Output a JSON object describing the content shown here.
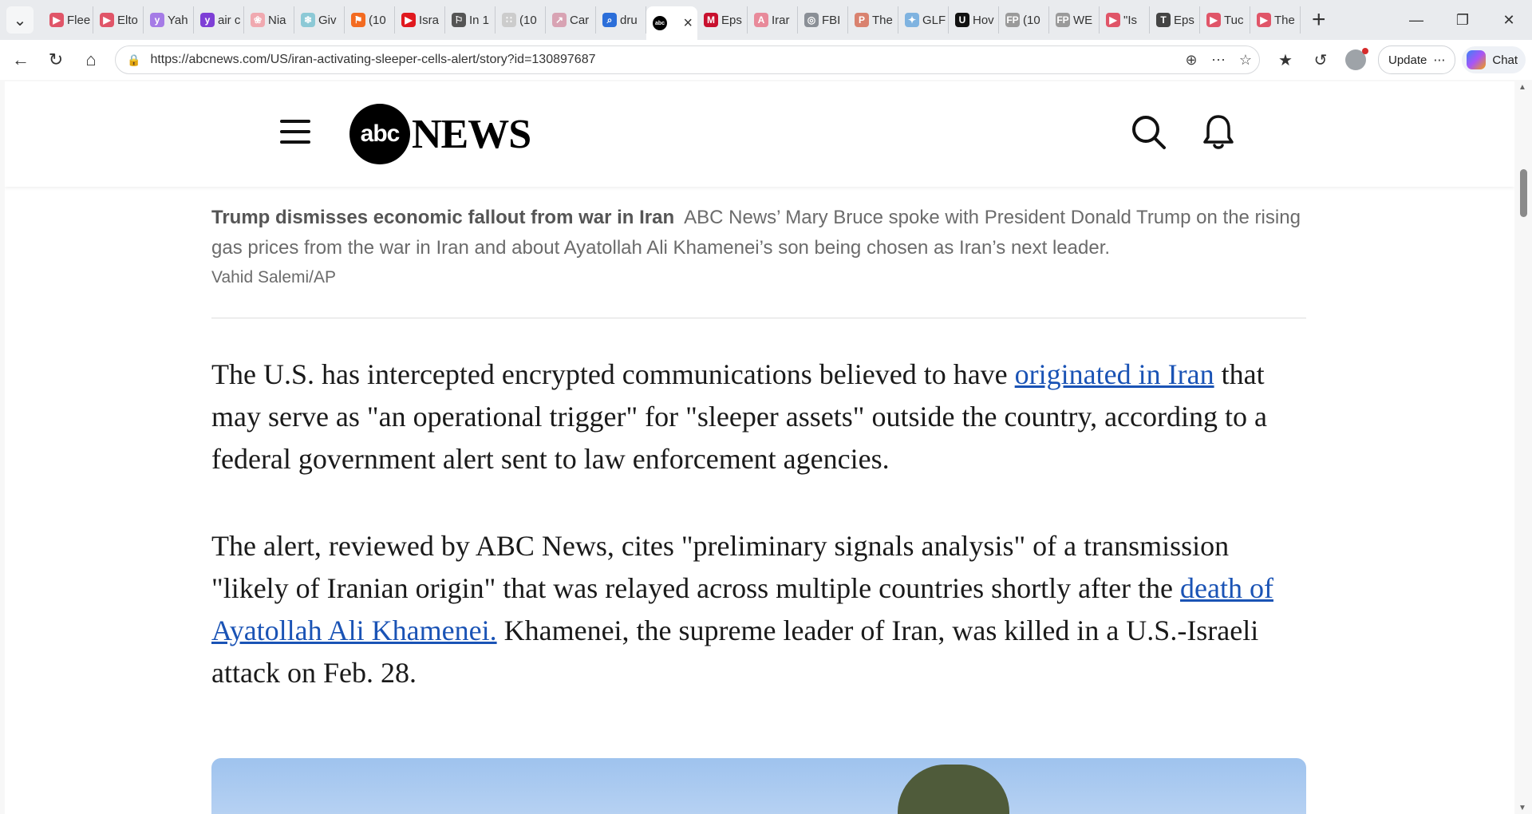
{
  "browser": {
    "tabs": [
      {
        "label": "Flee",
        "icon": "youtube-icon",
        "color": "#e05568"
      },
      {
        "label": "Elto",
        "icon": "youtube-icon",
        "color": "#e05568"
      },
      {
        "label": "Yah",
        "icon": "yahoo-icon",
        "color": "#a57be6"
      },
      {
        "label": "air c",
        "icon": "yahoo-icon",
        "color": "#7e3fd6"
      },
      {
        "label": "Nia",
        "icon": "maple-icon",
        "color": "#f0a9b0"
      },
      {
        "label": "Giv",
        "icon": "snowflake-icon",
        "color": "#8cc9d6"
      },
      {
        "label": "(10",
        "icon": "bookmark-icon",
        "color": "#f36b21"
      },
      {
        "label": "Isra",
        "icon": "youtube-icon",
        "color": "#e0191f"
      },
      {
        "label": "In 1",
        "icon": "flag-icon",
        "color": "#555555"
      },
      {
        "label": "(10",
        "icon": "page-icon",
        "color": "#cccccc"
      },
      {
        "label": "Car",
        "icon": "rocket-icon",
        "color": "#d8a3b3"
      },
      {
        "label": "dru",
        "icon": "search-icon",
        "color": "#2b6ed9"
      },
      {
        "label": "",
        "icon": "abc-icon",
        "color": "#000000",
        "active": true
      },
      {
        "label": "Eps",
        "icon": "m-icon",
        "color": "#c8102e"
      },
      {
        "label": "Irar",
        "icon": "a-icon",
        "color": "#e88a9a"
      },
      {
        "label": "FBI",
        "icon": "globe-icon",
        "color": "#8a8f96"
      },
      {
        "label": "The",
        "icon": "p-icon",
        "color": "#d9826f"
      },
      {
        "label": "GLF",
        "icon": "nbc-icon",
        "color": "#7fb3e0"
      },
      {
        "label": "Hov",
        "icon": "u-icon",
        "color": "#111111"
      },
      {
        "label": "(10",
        "icon": "fp-icon",
        "color": "#9a9a9a"
      },
      {
        "label": "WE",
        "icon": "fp-icon",
        "color": "#9a9a9a"
      },
      {
        "label": "\"Is",
        "icon": "youtube-icon",
        "color": "#e05568"
      },
      {
        "label": "Eps",
        "icon": "nyt-icon",
        "color": "#444444"
      },
      {
        "label": "Tuc",
        "icon": "youtube-icon",
        "color": "#e05568"
      },
      {
        "label": "The",
        "icon": "youtube-icon",
        "color": "#e05568"
      }
    ],
    "url": "https://abcnews.com/US/iran-activating-sleeper-cells-alert/story?id=130897687",
    "update_label": "Update",
    "chat_label": "Chat"
  },
  "site": {
    "logo_disc": "abc",
    "logo_word": "NEWS"
  },
  "article": {
    "caption_title": "Trump dismisses economic fallout from war in Iran",
    "caption_text": "ABC News’ Mary Bruce spoke with President Donald Trump on the rising gas prices from the war in Iran and about Ayatollah Ali Khamenei’s son being chosen as Iran’s next leader.",
    "credit": "Vahid Salemi/AP",
    "p1_before": "The U.S. has intercepted encrypted communications believed to have ",
    "p1_link": "originated in Iran",
    "p1_after": " that may serve as \"an operational trigger\" for \"sleeper assets\" outside the country, according to a federal government alert sent to law enforcement agencies.",
    "p2_before": "The alert, reviewed by ABC News, cites \"preliminary signals analysis\" of a transmission \"likely of Iranian origin\" that was relayed across multiple countries shortly after the ",
    "p2_link": "death of Ayatollah Ali Khamenei.",
    "p2_after": " Khamenei, the supreme leader of Iran, was killed in a U.S.-Israeli attack on Feb. 28."
  }
}
